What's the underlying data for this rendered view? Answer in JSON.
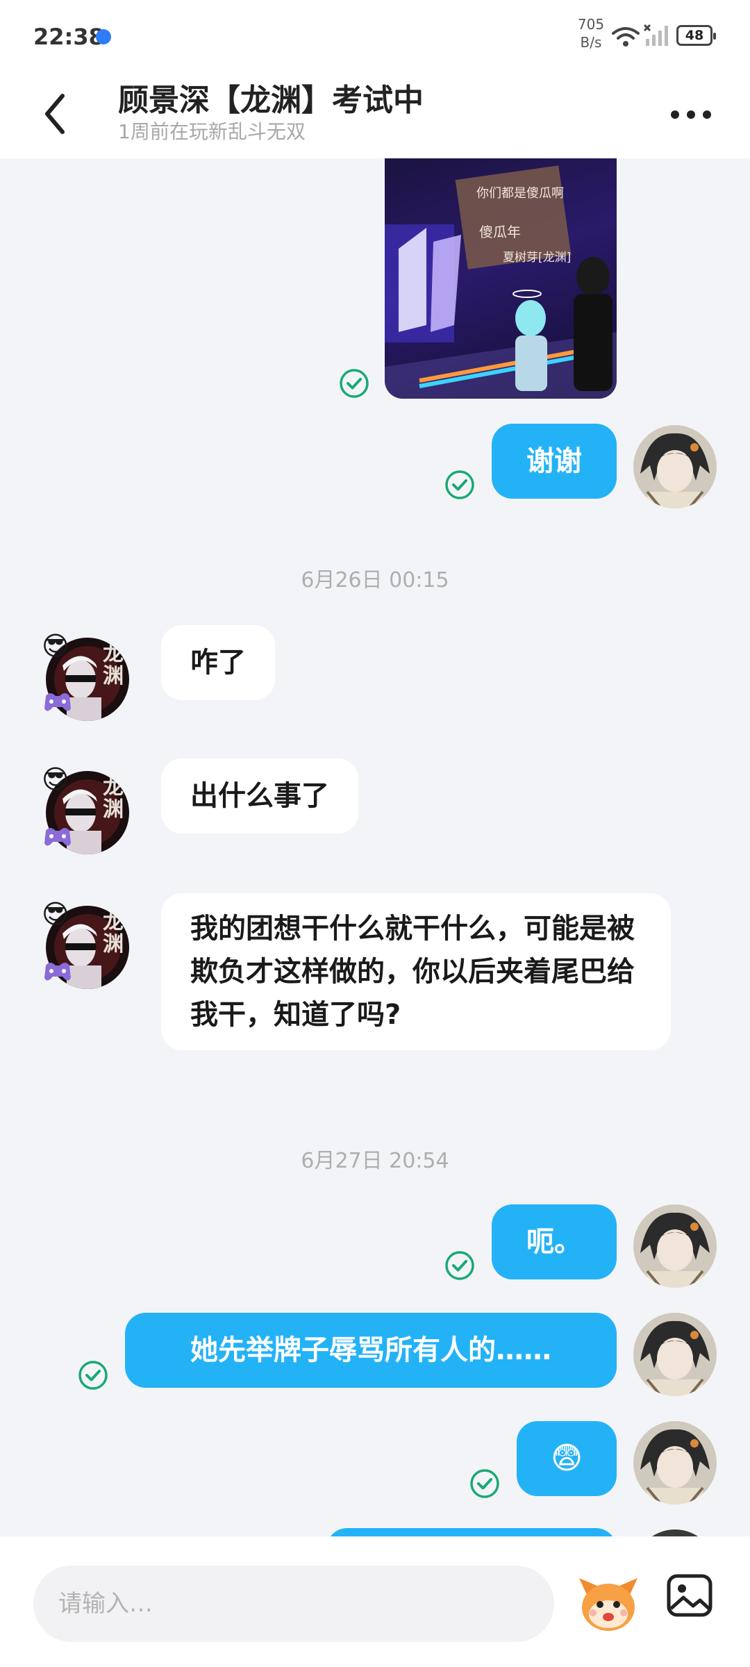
{
  "status_bar": {
    "time": "22:38",
    "net_speed_value": "705",
    "net_speed_unit": "B/s",
    "battery": "48"
  },
  "header": {
    "title": "顾景深【龙渊】考试中",
    "subtitle": "1周前在玩新乱斗无双"
  },
  "shared_image": {
    "text_line1": "你们都是傻瓜啊",
    "text_line2": "傻瓜年",
    "text_line3": "夏树芽[龙渊]"
  },
  "messages": {
    "out_1": "谢谢",
    "timestamp_1": "6月26日 00:15",
    "in_1": "咋了",
    "in_2": "出什么事了",
    "in_3": "我的团想干什么就干什么，可能是被欺负才这样做的，你以后夹着尾巴给我干，知道了吗?",
    "timestamp_2": "6月27日 20:54",
    "out_2": "呃。",
    "out_3": "她先举牌子辱骂所有人的……",
    "out_4": "😨"
  },
  "contact_avatar": {
    "text": "龙渊",
    "emoji": "😎"
  },
  "composer": {
    "placeholder": "请输入…"
  },
  "colors": {
    "outgoing_bubble": "#24B2F7",
    "incoming_bubble": "#FFFFFF",
    "read_check": "#19A974",
    "background": "#F3F4F8"
  },
  "icons": [
    "back-icon",
    "more-icon",
    "read-check-icon",
    "mascot-icon",
    "image-icon",
    "wifi-icon",
    "signal-icon",
    "battery-icon"
  ]
}
